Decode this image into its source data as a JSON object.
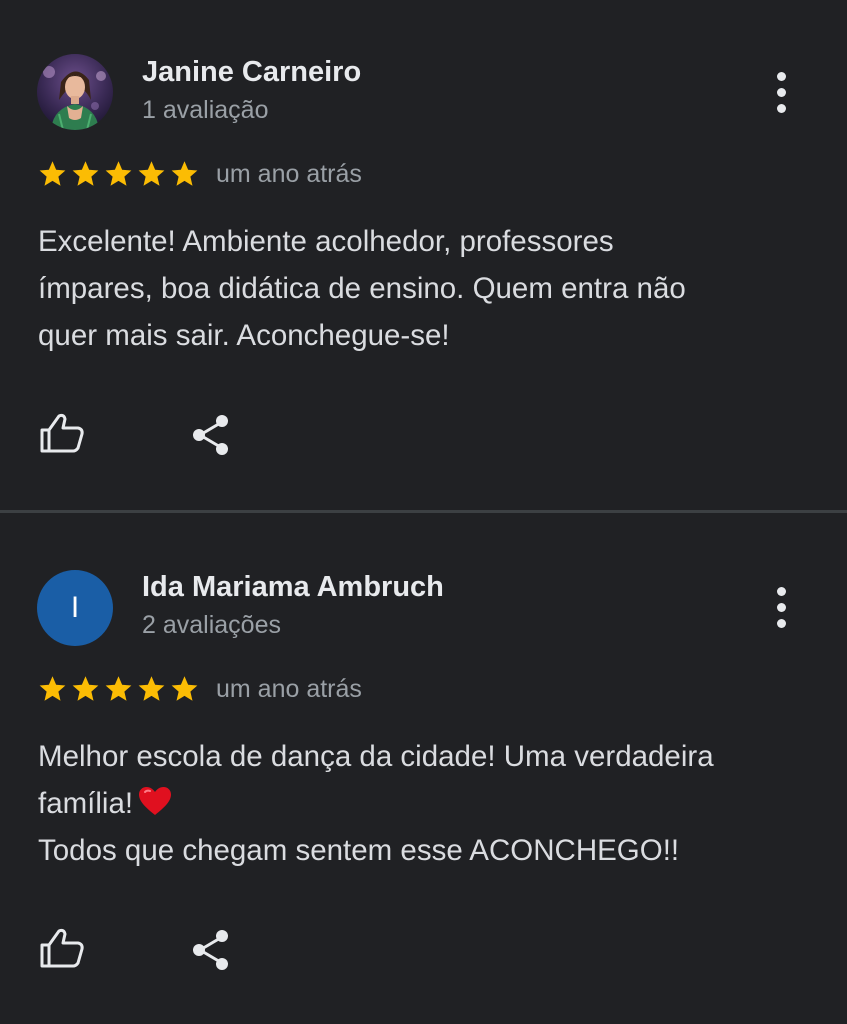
{
  "reviews": [
    {
      "author": "Janine Carneiro",
      "review_count": "1 avaliação",
      "rating": 5,
      "max_rating": 5,
      "time_ago": "um ano atrás",
      "text": "Excelente! Ambiente acolhedor, professores\nímpares, boa didática de ensino. Quem entra não\nquer mais sair. Aconchegue-se!",
      "avatar": {
        "type": "photo"
      }
    },
    {
      "author": "Ida Mariama Ambruch",
      "review_count": "2 avaliações",
      "rating": 5,
      "max_rating": 5,
      "time_ago": "um ano atrás",
      "text_line1": "Melhor escola de dança da cidade! Uma verdadeira\nfamília!",
      "text_line2": "\nTodos que chegam sentem esse ACONCHEGO!!",
      "avatar": {
        "type": "letter",
        "letter": "I",
        "color": "#1a5ea6"
      }
    }
  ],
  "icons": {
    "like": "thumb-up-outline-icon",
    "share": "share-icon",
    "more": "more-vert-icon",
    "star": "star-icon",
    "heart": "red-heart-emoji"
  },
  "colors": {
    "background": "#202124",
    "star": "#fbbc04",
    "primary_text": "#e8eaed",
    "secondary_text": "#9aa0a6",
    "divider": "#3c4043",
    "heart": "#e0101f"
  }
}
